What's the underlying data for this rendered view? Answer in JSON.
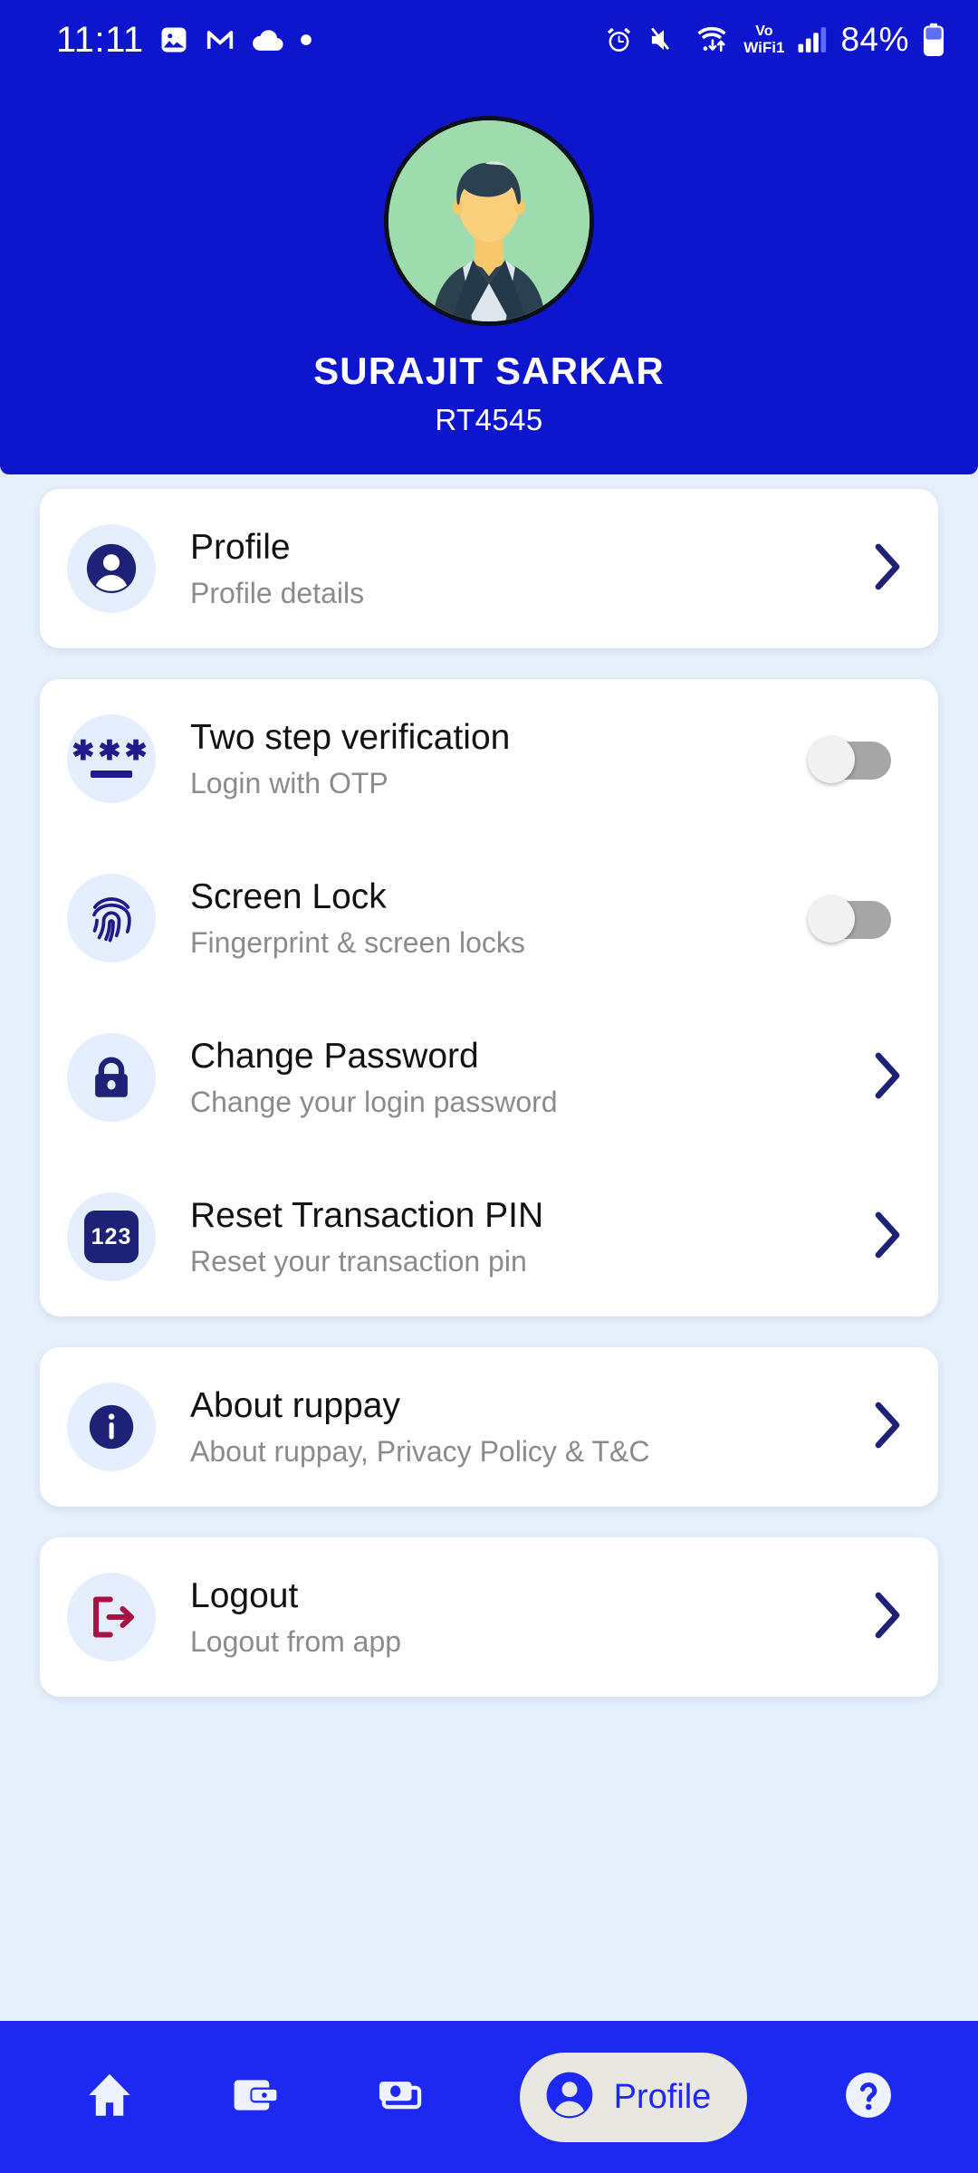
{
  "status_bar": {
    "time": "11:11",
    "left_icons": [
      "photos-icon",
      "gmail-icon",
      "cloud-icon",
      "dot-icon"
    ],
    "right_icons": [
      "alarm-icon",
      "mute-icon",
      "wifi-data-icon",
      "signal-bars-icon",
      "battery-icon"
    ],
    "vowifi_top": "Vo",
    "vowifi_bottom": "WiFi1",
    "battery_percent": "84%"
  },
  "header": {
    "avatar": "user-avatar-illustration",
    "name": "SURAJIT SARKAR",
    "user_id": "RT4545",
    "bg_color": "#0d16cc"
  },
  "cards": [
    {
      "name": "profile-card",
      "rows": [
        {
          "key": "profile",
          "icon": "person-icon",
          "title": "Profile",
          "subtitle": "Profile details",
          "control": "chevron"
        }
      ]
    },
    {
      "name": "security-card",
      "rows": [
        {
          "key": "two-step-verification",
          "icon": "password-asterisks-icon",
          "title": "Two step verification",
          "subtitle": "Login with OTP",
          "control": "toggle",
          "toggle_on": false
        },
        {
          "key": "screen-lock",
          "icon": "fingerprint-icon",
          "title": "Screen Lock",
          "subtitle": "Fingerprint & screen locks",
          "control": "toggle",
          "toggle_on": false
        },
        {
          "key": "change-password",
          "icon": "lock-icon",
          "title": "Change Password",
          "subtitle": "Change your login password",
          "control": "chevron"
        },
        {
          "key": "reset-transaction-pin",
          "icon": "numeric-123-icon",
          "title": "Reset Transaction PIN",
          "subtitle": "Reset your transaction pin",
          "control": "chevron",
          "icon_text": "123"
        }
      ]
    },
    {
      "name": "about-card",
      "rows": [
        {
          "key": "about-ruppay",
          "icon": "info-icon",
          "title": "About ruppay",
          "subtitle": "About ruppay, Privacy Policy & T&C",
          "control": "chevron"
        }
      ]
    },
    {
      "name": "logout-card",
      "rows": [
        {
          "key": "logout",
          "icon": "logout-icon",
          "title": "Logout",
          "subtitle": "Logout from app",
          "control": "chevron"
        }
      ]
    }
  ],
  "bottom_nav": {
    "bg_color": "#1d29f0",
    "items": [
      {
        "key": "home",
        "icon": "home-icon",
        "label": "",
        "active": false
      },
      {
        "key": "wallet",
        "icon": "wallet-icon",
        "label": "",
        "active": false
      },
      {
        "key": "money",
        "icon": "cash-stack-icon",
        "label": "",
        "active": false
      },
      {
        "key": "profile",
        "icon": "person-icon",
        "label": "Profile",
        "active": true
      },
      {
        "key": "help",
        "icon": "help-icon",
        "label": "",
        "active": false
      }
    ]
  },
  "colors": {
    "header_blue": "#0d16cc",
    "nav_blue": "#1d29f0",
    "page_bg": "#e6f0fb",
    "icon_circle": "#e4eefc",
    "icon_navy": "#1e2277",
    "logout_red": "#a81240",
    "subtitle_grey": "#8b8b8b",
    "pill_bg": "#e9e7e2"
  }
}
